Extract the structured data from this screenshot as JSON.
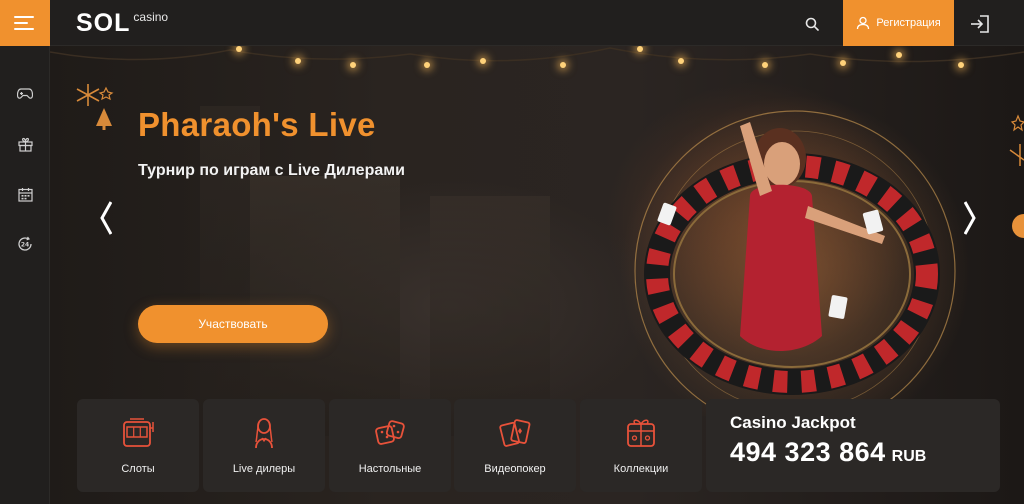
{
  "header": {
    "logo_text": "SOL",
    "logo_sub": "casino",
    "register_label": "Регистрация"
  },
  "icons": {
    "menu": "hamburger-menu-icon",
    "search": "search-icon",
    "user": "user-icon",
    "login": "login-icon",
    "sidebar": [
      "gamepad-icon",
      "gift-icon",
      "calendar-icon",
      "support-24-icon"
    ]
  },
  "banner": {
    "title": "Pharaoh's Live",
    "subtitle": "Турнир по играм с Live Дилерами",
    "cta_label": "Участвовать"
  },
  "categories": [
    {
      "label": "Слоты",
      "icon": "slot-machine-icon"
    },
    {
      "label": "Live дилеры",
      "icon": "live-dealer-icon"
    },
    {
      "label": "Настольные",
      "icon": "dice-icon"
    },
    {
      "label": "Видеопокер",
      "icon": "cards-icon"
    },
    {
      "label": "Коллекции",
      "icon": "collections-icon"
    }
  ],
  "jackpot": {
    "title": "Casino Jackpot",
    "amount": "494 323 864",
    "currency": "RUB"
  },
  "colors": {
    "accent": "#f0912e",
    "bg": "#1c1a19",
    "card": "#2b2826"
  }
}
